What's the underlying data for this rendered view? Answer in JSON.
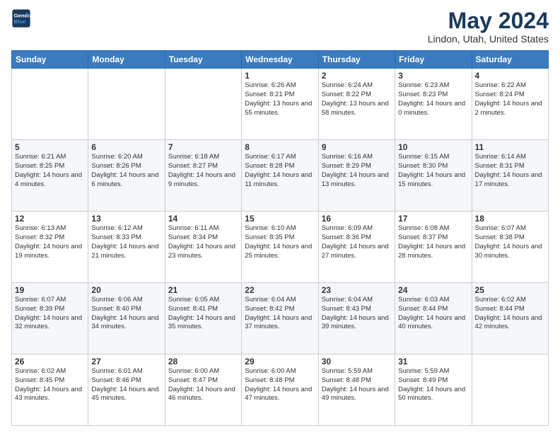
{
  "header": {
    "logo_line1": "General",
    "logo_line2": "Blue",
    "month": "May 2024",
    "location": "Lindon, Utah, United States"
  },
  "days_of_week": [
    "Sunday",
    "Monday",
    "Tuesday",
    "Wednesday",
    "Thursday",
    "Friday",
    "Saturday"
  ],
  "weeks": [
    [
      {
        "day": "",
        "sunrise": "",
        "sunset": "",
        "daylight": ""
      },
      {
        "day": "",
        "sunrise": "",
        "sunset": "",
        "daylight": ""
      },
      {
        "day": "",
        "sunrise": "",
        "sunset": "",
        "daylight": ""
      },
      {
        "day": "1",
        "sunrise": "Sunrise: 6:26 AM",
        "sunset": "Sunset: 8:21 PM",
        "daylight": "Daylight: 13 hours and 55 minutes."
      },
      {
        "day": "2",
        "sunrise": "Sunrise: 6:24 AM",
        "sunset": "Sunset: 8:22 PM",
        "daylight": "Daylight: 13 hours and 58 minutes."
      },
      {
        "day": "3",
        "sunrise": "Sunrise: 6:23 AM",
        "sunset": "Sunset: 8:23 PM",
        "daylight": "Daylight: 14 hours and 0 minutes."
      },
      {
        "day": "4",
        "sunrise": "Sunrise: 6:22 AM",
        "sunset": "Sunset: 8:24 PM",
        "daylight": "Daylight: 14 hours and 2 minutes."
      }
    ],
    [
      {
        "day": "5",
        "sunrise": "Sunrise: 6:21 AM",
        "sunset": "Sunset: 8:25 PM",
        "daylight": "Daylight: 14 hours and 4 minutes."
      },
      {
        "day": "6",
        "sunrise": "Sunrise: 6:20 AM",
        "sunset": "Sunset: 8:26 PM",
        "daylight": "Daylight: 14 hours and 6 minutes."
      },
      {
        "day": "7",
        "sunrise": "Sunrise: 6:18 AM",
        "sunset": "Sunset: 8:27 PM",
        "daylight": "Daylight: 14 hours and 9 minutes."
      },
      {
        "day": "8",
        "sunrise": "Sunrise: 6:17 AM",
        "sunset": "Sunset: 8:28 PM",
        "daylight": "Daylight: 14 hours and 11 minutes."
      },
      {
        "day": "9",
        "sunrise": "Sunrise: 6:16 AM",
        "sunset": "Sunset: 8:29 PM",
        "daylight": "Daylight: 14 hours and 13 minutes."
      },
      {
        "day": "10",
        "sunrise": "Sunrise: 6:15 AM",
        "sunset": "Sunset: 8:30 PM",
        "daylight": "Daylight: 14 hours and 15 minutes."
      },
      {
        "day": "11",
        "sunrise": "Sunrise: 6:14 AM",
        "sunset": "Sunset: 8:31 PM",
        "daylight": "Daylight: 14 hours and 17 minutes."
      }
    ],
    [
      {
        "day": "12",
        "sunrise": "Sunrise: 6:13 AM",
        "sunset": "Sunset: 8:32 PM",
        "daylight": "Daylight: 14 hours and 19 minutes."
      },
      {
        "day": "13",
        "sunrise": "Sunrise: 6:12 AM",
        "sunset": "Sunset: 8:33 PM",
        "daylight": "Daylight: 14 hours and 21 minutes."
      },
      {
        "day": "14",
        "sunrise": "Sunrise: 6:11 AM",
        "sunset": "Sunset: 8:34 PM",
        "daylight": "Daylight: 14 hours and 23 minutes."
      },
      {
        "day": "15",
        "sunrise": "Sunrise: 6:10 AM",
        "sunset": "Sunset: 8:35 PM",
        "daylight": "Daylight: 14 hours and 25 minutes."
      },
      {
        "day": "16",
        "sunrise": "Sunrise: 6:09 AM",
        "sunset": "Sunset: 8:36 PM",
        "daylight": "Daylight: 14 hours and 27 minutes."
      },
      {
        "day": "17",
        "sunrise": "Sunrise: 6:08 AM",
        "sunset": "Sunset: 8:37 PM",
        "daylight": "Daylight: 14 hours and 28 minutes."
      },
      {
        "day": "18",
        "sunrise": "Sunrise: 6:07 AM",
        "sunset": "Sunset: 8:38 PM",
        "daylight": "Daylight: 14 hours and 30 minutes."
      }
    ],
    [
      {
        "day": "19",
        "sunrise": "Sunrise: 6:07 AM",
        "sunset": "Sunset: 8:39 PM",
        "daylight": "Daylight: 14 hours and 32 minutes."
      },
      {
        "day": "20",
        "sunrise": "Sunrise: 6:06 AM",
        "sunset": "Sunset: 8:40 PM",
        "daylight": "Daylight: 14 hours and 34 minutes."
      },
      {
        "day": "21",
        "sunrise": "Sunrise: 6:05 AM",
        "sunset": "Sunset: 8:41 PM",
        "daylight": "Daylight: 14 hours and 35 minutes."
      },
      {
        "day": "22",
        "sunrise": "Sunrise: 6:04 AM",
        "sunset": "Sunset: 8:42 PM",
        "daylight": "Daylight: 14 hours and 37 minutes."
      },
      {
        "day": "23",
        "sunrise": "Sunrise: 6:04 AM",
        "sunset": "Sunset: 8:43 PM",
        "daylight": "Daylight: 14 hours and 39 minutes."
      },
      {
        "day": "24",
        "sunrise": "Sunrise: 6:03 AM",
        "sunset": "Sunset: 8:44 PM",
        "daylight": "Daylight: 14 hours and 40 minutes."
      },
      {
        "day": "25",
        "sunrise": "Sunrise: 6:02 AM",
        "sunset": "Sunset: 8:44 PM",
        "daylight": "Daylight: 14 hours and 42 minutes."
      }
    ],
    [
      {
        "day": "26",
        "sunrise": "Sunrise: 6:02 AM",
        "sunset": "Sunset: 8:45 PM",
        "daylight": "Daylight: 14 hours and 43 minutes."
      },
      {
        "day": "27",
        "sunrise": "Sunrise: 6:01 AM",
        "sunset": "Sunset: 8:46 PM",
        "daylight": "Daylight: 14 hours and 45 minutes."
      },
      {
        "day": "28",
        "sunrise": "Sunrise: 6:00 AM",
        "sunset": "Sunset: 8:47 PM",
        "daylight": "Daylight: 14 hours and 46 minutes."
      },
      {
        "day": "29",
        "sunrise": "Sunrise: 6:00 AM",
        "sunset": "Sunset: 8:48 PM",
        "daylight": "Daylight: 14 hours and 47 minutes."
      },
      {
        "day": "30",
        "sunrise": "Sunrise: 5:59 AM",
        "sunset": "Sunset: 8:48 PM",
        "daylight": "Daylight: 14 hours and 49 minutes."
      },
      {
        "day": "31",
        "sunrise": "Sunrise: 5:59 AM",
        "sunset": "Sunset: 8:49 PM",
        "daylight": "Daylight: 14 hours and 50 minutes."
      },
      {
        "day": "",
        "sunrise": "",
        "sunset": "",
        "daylight": ""
      }
    ]
  ]
}
